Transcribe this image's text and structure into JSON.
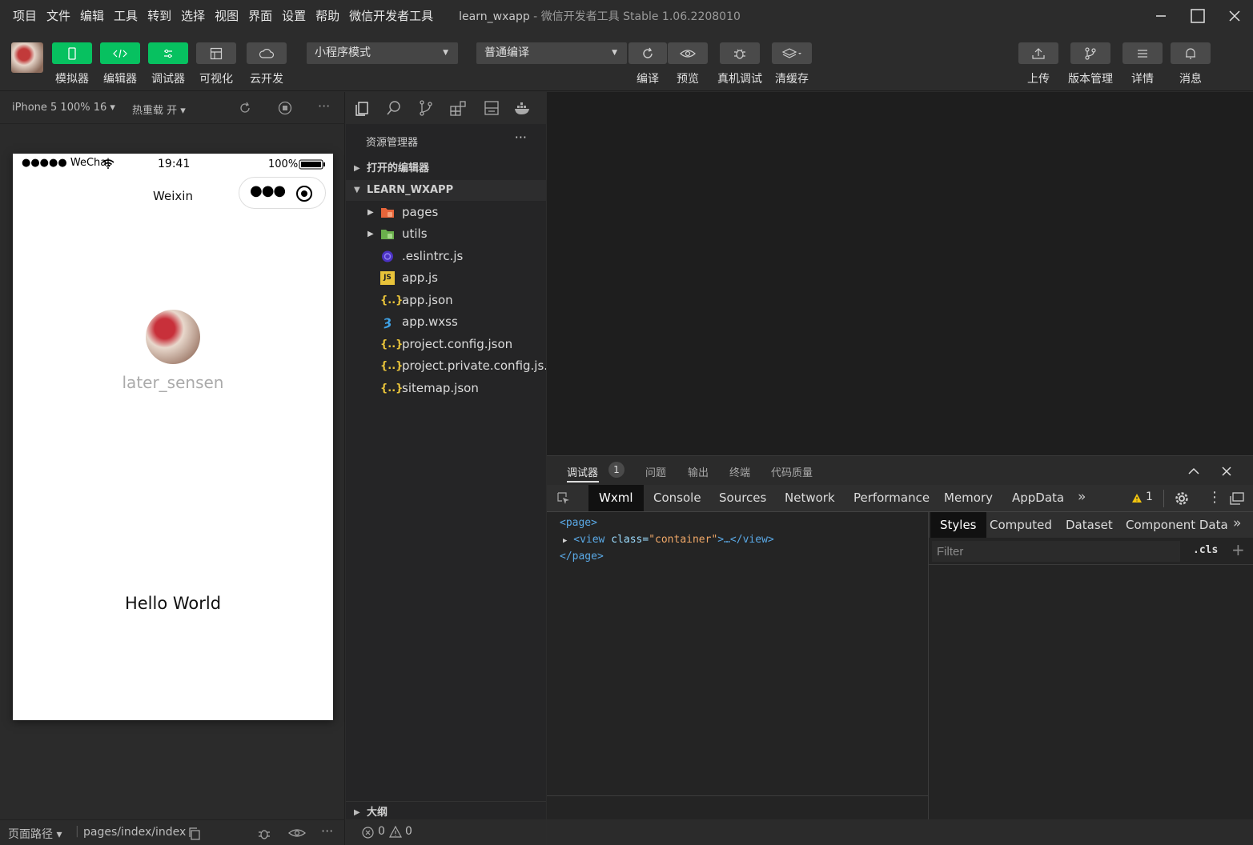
{
  "menu": [
    "项目",
    "文件",
    "编辑",
    "工具",
    "转到",
    "选择",
    "视图",
    "界面",
    "设置",
    "帮助",
    "微信开发者工具"
  ],
  "window": {
    "project": "learn_wxapp",
    "separator": " - ",
    "app": "微信开发者工具 Stable 1.06.2208010"
  },
  "toolbar": {
    "simulator": "模拟器",
    "editor": "编辑器",
    "debugger": "调试器",
    "visual": "可视化",
    "cloud": "云开发",
    "mode": "小程序模式",
    "compile_mode": "普通编译",
    "compile": "编译",
    "preview": "预览",
    "remote_debug": "真机调试",
    "clear_cache": "清缓存",
    "upload": "上传",
    "version": "版本管理",
    "details": "详情",
    "messages": "消息"
  },
  "simbar": {
    "device": "iPhone 5 100% 16 ▾",
    "hot_reload": "热重载 开 ▾"
  },
  "phone": {
    "carrier": "●●●●● WeChat",
    "time": "19:41",
    "battery": "100%",
    "nav_title": "Weixin",
    "nickname": "later_sensen",
    "hello": "Hello World"
  },
  "simfoot": {
    "page_path_label": "页面路径 ▾",
    "page_path": "pages/index/index"
  },
  "explorer": {
    "title": "资源管理器",
    "open_editors": "打开的编辑器",
    "project": "LEARN_WXAPP",
    "files": [
      {
        "name": "pages",
        "type": "folder"
      },
      {
        "name": "utils",
        "type": "folder"
      },
      {
        "name": ".eslintrc.js",
        "type": "eslint"
      },
      {
        "name": "app.js",
        "type": "js"
      },
      {
        "name": "app.json",
        "type": "json"
      },
      {
        "name": "app.wxss",
        "type": "css"
      },
      {
        "name": "project.config.json",
        "type": "json"
      },
      {
        "name": "project.private.config.js...",
        "type": "json"
      },
      {
        "name": "sitemap.json",
        "type": "json"
      }
    ],
    "outline": "大纲",
    "errors": "0",
    "warnings": "0"
  },
  "debug": {
    "tabs": [
      "调试器",
      "问题",
      "输出",
      "终端",
      "代码质量"
    ],
    "badge": "1",
    "devtools_tabs": [
      "Wxml",
      "Console",
      "Sources",
      "Network",
      "Performance",
      "Memory",
      "AppData"
    ],
    "warn_count": "1",
    "wxml": {
      "open_tag": "<page>",
      "view_open": "<view",
      "attr": " class=",
      "attr_value": "\"container\"",
      "view_rest": ">…</view>",
      "close_tag": "</page>"
    },
    "styles_tabs": [
      "Styles",
      "Computed",
      "Dataset",
      "Component Data"
    ],
    "filter_placeholder": "Filter",
    "cls": ".cls"
  }
}
